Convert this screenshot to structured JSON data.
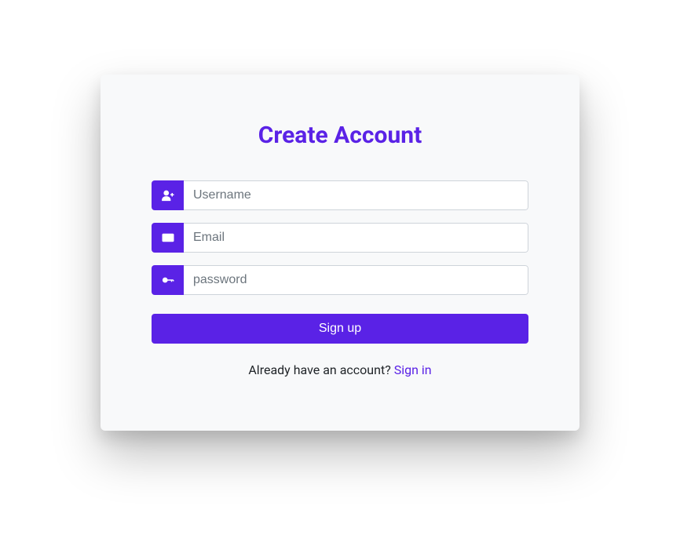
{
  "title": "Create Account",
  "form": {
    "username": {
      "placeholder": "Username",
      "icon": "user-plus-icon"
    },
    "email": {
      "placeholder": "Email",
      "icon": "envelope-icon"
    },
    "password": {
      "placeholder": "password",
      "icon": "key-icon"
    },
    "submit_label": "Sign up"
  },
  "footer": {
    "prompt": "Already have an account? ",
    "link_label": "Sign in"
  },
  "colors": {
    "accent": "#5a22e6",
    "card_bg": "#f8f9fa"
  }
}
